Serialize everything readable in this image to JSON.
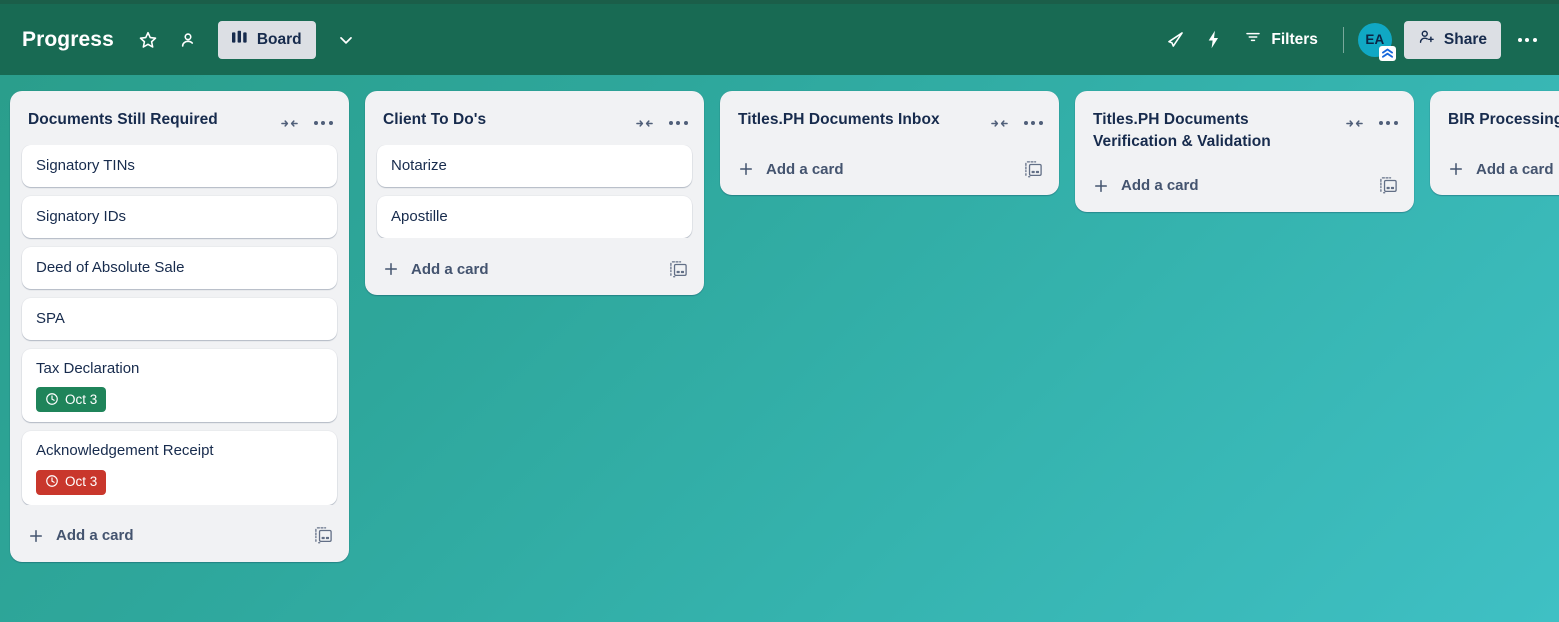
{
  "header": {
    "board_title": "Progress",
    "star_icon": "star-icon",
    "workspace_visibility_icon": "workspace-visibility-icon",
    "view_button": {
      "label": "Board",
      "icon": "board-view-icon"
    },
    "view_chevron_icon": "chevron-down-icon",
    "rocket_icon": "rocket-icon",
    "automation_icon": "lightning-bolt-icon",
    "filters": {
      "label": "Filters",
      "icon": "filter-icon"
    },
    "avatar": {
      "initials": "EA",
      "badge_icon": "premium-chevrons-badge-icon",
      "color": "#10a8c4"
    },
    "share": {
      "label": "Share",
      "icon": "person-add-icon"
    },
    "overflow_menu_icon": "ellipsis-icon",
    "bar_color": "#186a53"
  },
  "board": {
    "background_colors": [
      "#2a9d8a",
      "#3fc0c4"
    ],
    "list_header_icons": {
      "collapse": "collapse-list-icon",
      "menu": "ellipsis-icon"
    },
    "add_card": {
      "label": "Add a card",
      "plus_icon": "plus-icon",
      "template_icon": "card-template-icon"
    },
    "lists": [
      {
        "title": "Documents Still Required",
        "cards": [
          {
            "title": "Signatory TINs",
            "due": null
          },
          {
            "title": "Signatory IDs",
            "due": null
          },
          {
            "title": "Deed of Absolute Sale",
            "due": null
          },
          {
            "title": "SPA",
            "due": null
          },
          {
            "title": "Tax Declaration",
            "due": {
              "label": "Oct 3",
              "state": "green",
              "color": "#1f845a",
              "icon": "clock-icon"
            }
          },
          {
            "title": "Acknowledgement Receipt",
            "due": {
              "label": "Oct 3",
              "state": "red",
              "color": "#c9372c",
              "icon": "clock-icon"
            }
          }
        ]
      },
      {
        "title": "Client To Do's",
        "cards": [
          {
            "title": "Notarize",
            "due": null
          },
          {
            "title": "Apostille",
            "due": null
          }
        ]
      },
      {
        "title": "Titles.PH Documents Inbox",
        "cards": []
      },
      {
        "title": "Titles.PH Documents Verification & Validation",
        "cards": []
      },
      {
        "title": "BIR Processing",
        "cards": []
      }
    ]
  }
}
